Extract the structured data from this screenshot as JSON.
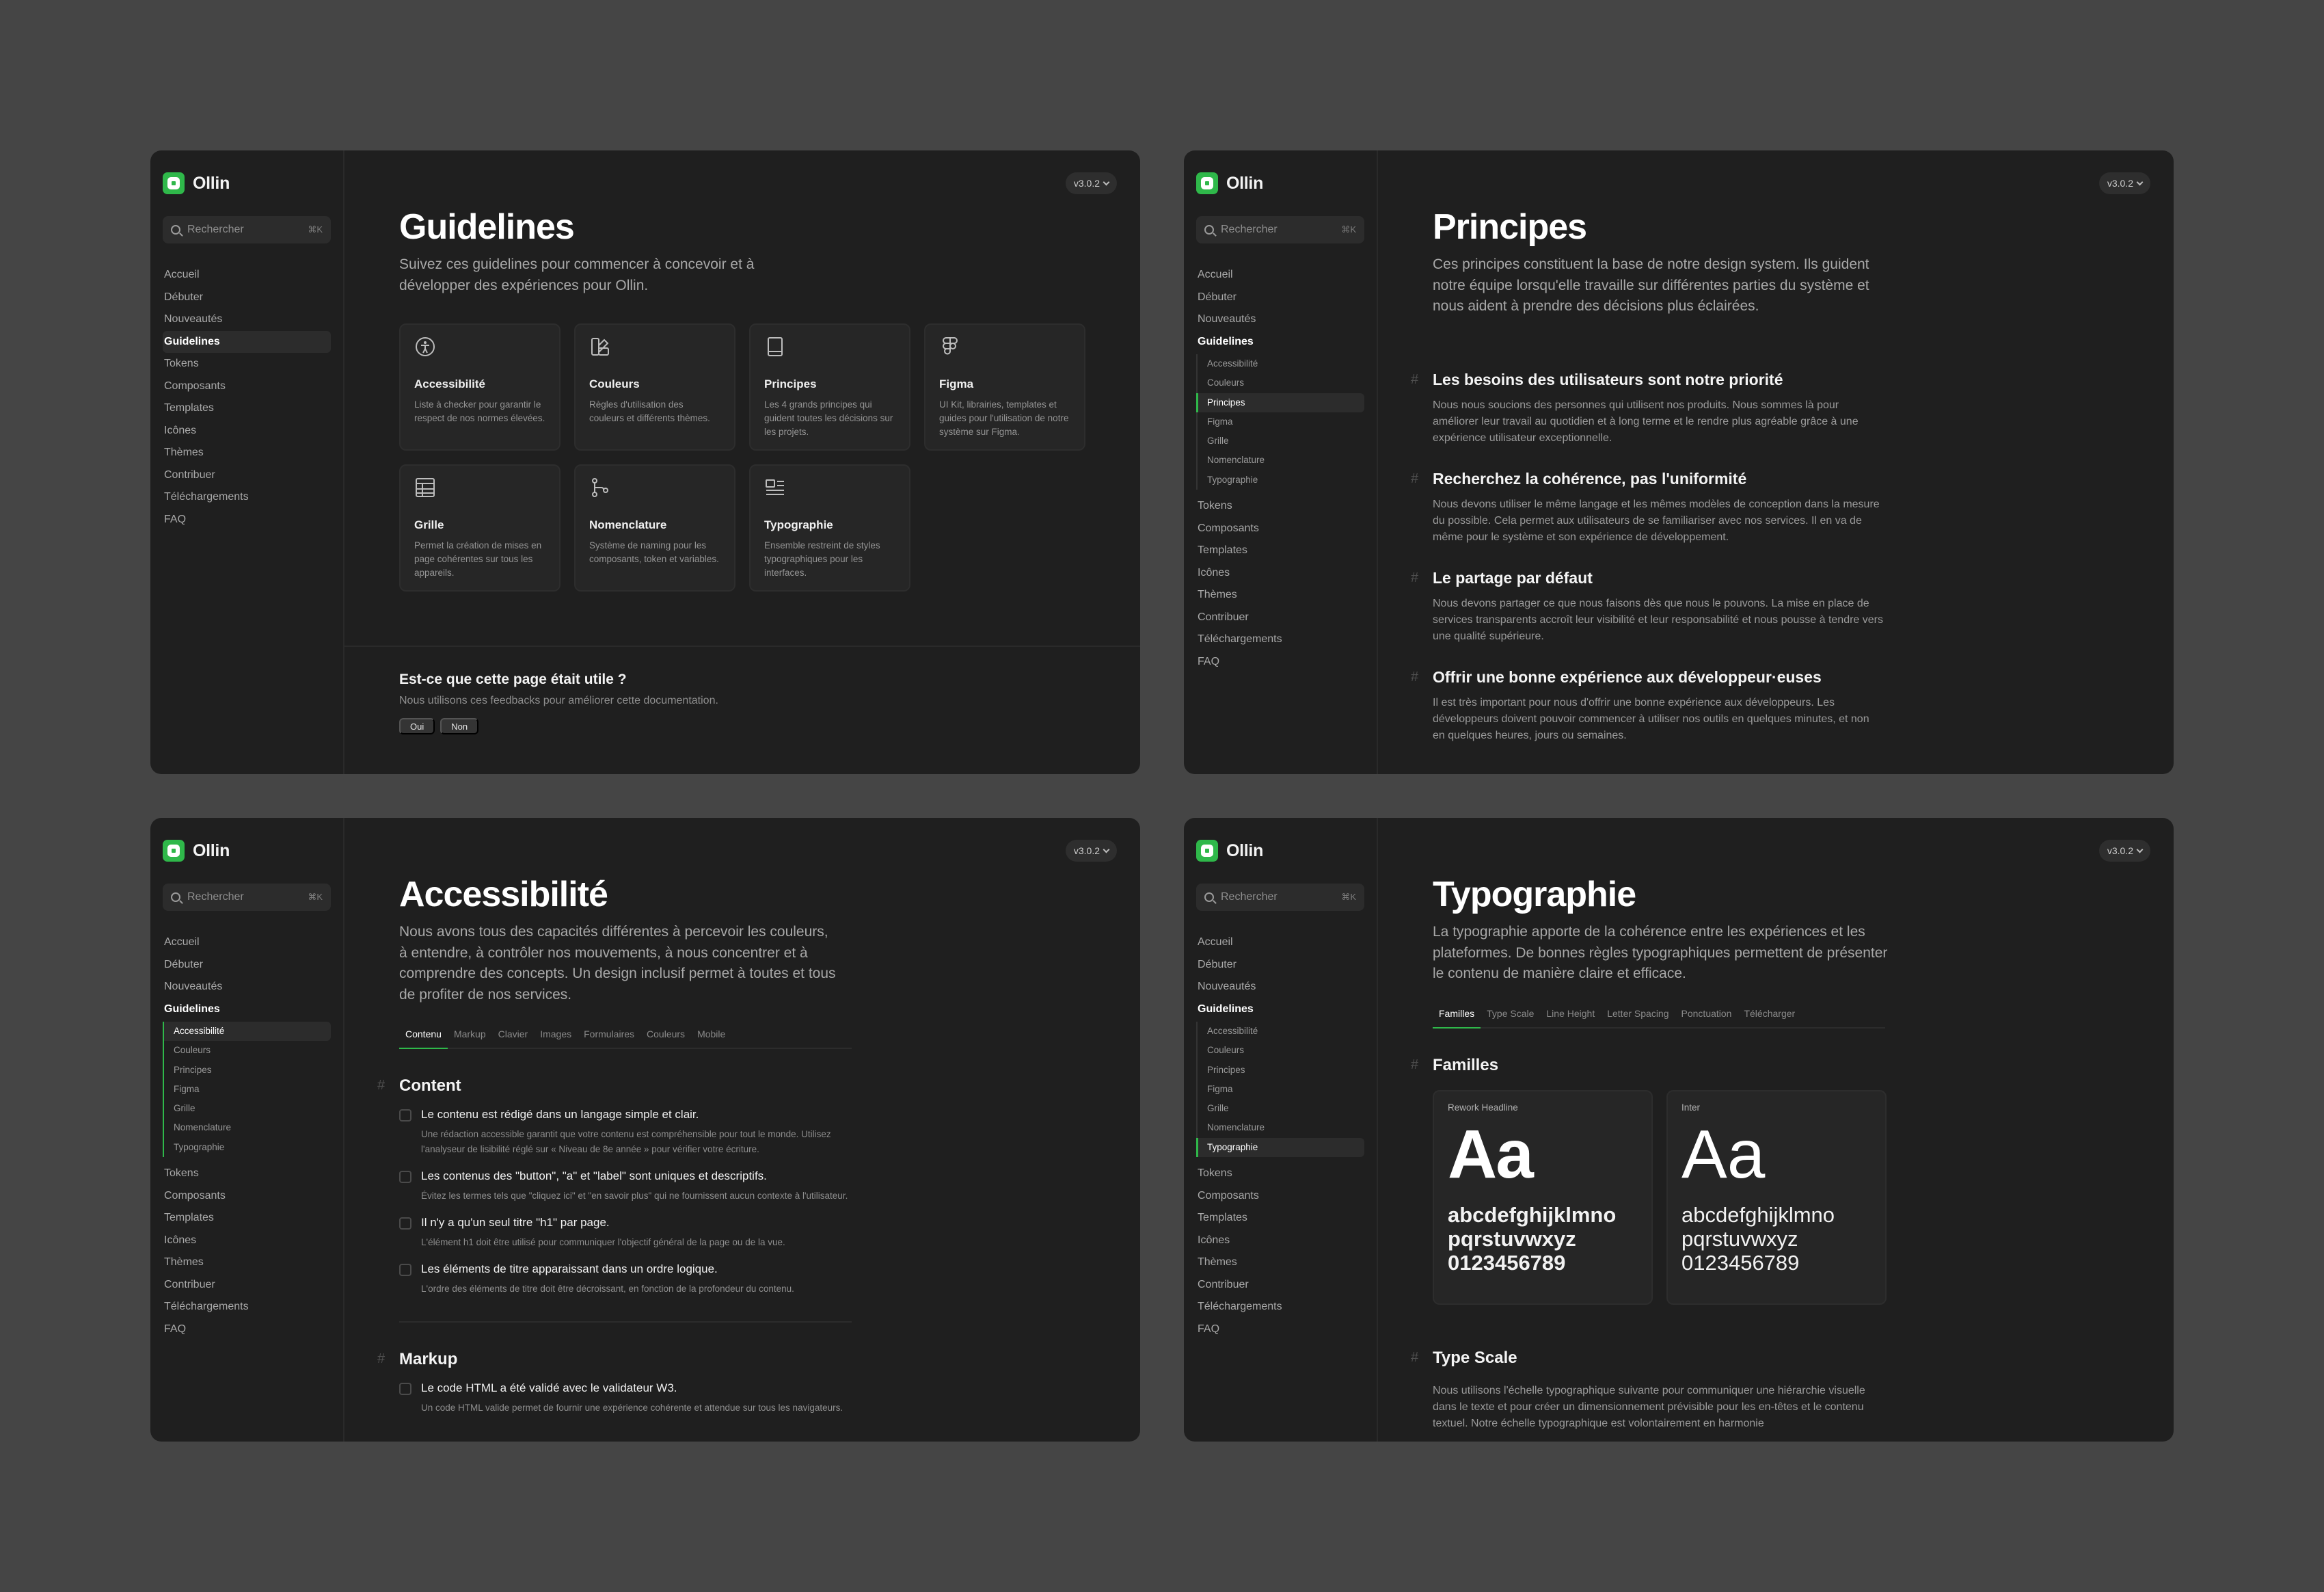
{
  "common": {
    "brand": "Ollin",
    "search_placeholder": "Rechercher",
    "search_shortcut": "⌘K",
    "version": "v3.0.2",
    "accent": "#2fb84a",
    "nav_top": [
      "Accueil",
      "Débuter",
      "Nouveautés",
      "Guidelines"
    ],
    "nav_bottom": [
      "Tokens",
      "Composants",
      "Templates",
      "Icônes",
      "Thèmes",
      "Contribuer",
      "Téléchargements",
      "FAQ"
    ],
    "sub_nav": [
      "Accessibilité",
      "Couleurs",
      "Principes",
      "Figma",
      "Grille",
      "Nomenclature",
      "Typographie"
    ]
  },
  "guidelines": {
    "title": "Guidelines",
    "lead": "Suivez ces guidelines pour commencer à concevoir et à développer des expériences pour Ollin.",
    "cards": [
      {
        "icon": "accessibility-icon",
        "title": "Accessibilité",
        "desc": "Liste à checker pour garantir le respect de nos normes élevées."
      },
      {
        "icon": "palette-icon",
        "title": "Couleurs",
        "desc": "Règles d'utilisation des couleurs et différents thèmes."
      },
      {
        "icon": "book-icon",
        "title": "Principes",
        "desc": "Les 4 grands principes qui guident toutes les décisions sur les projets."
      },
      {
        "icon": "figma-icon",
        "title": "Figma",
        "desc": "UI Kit, librairies, templates et guides pour l'utilisation de notre système sur Figma."
      },
      {
        "icon": "grid-icon",
        "title": "Grille",
        "desc": "Permet la création de mises en page cohérentes sur tous les appareils."
      },
      {
        "icon": "nodes-icon",
        "title": "Nomenclature",
        "desc": "Système de naming pour les composants, token et variables."
      },
      {
        "icon": "text-icon",
        "title": "Typographie",
        "desc": "Ensemble restreint de styles typographiques pour les interfaces."
      }
    ],
    "feedback": {
      "title": "Est-ce que cette page était utile ?",
      "subtitle": "Nous utilisons ces feedbacks pour améliorer cette documentation.",
      "yes": "Oui",
      "no": "Non"
    }
  },
  "principes": {
    "title": "Principes",
    "lead": "Ces principes constituent la base de notre design system. Ils guident notre équipe lorsqu'elle travaille sur différentes parties du système et nous aident à prendre des décisions plus éclairées.",
    "items": [
      {
        "title": "Les besoins des utilisateurs sont notre priorité",
        "text": "Nous nous soucions des personnes qui utilisent nos produits. Nous sommes là pour améliorer leur travail au quotidien et à long terme et le rendre plus agréable grâce à une expérience utilisateur exceptionnelle."
      },
      {
        "title": "Recherchez la cohérence, pas l'uniformité",
        "text": "Nous devons utiliser le même langage et les mêmes modèles de conception dans la mesure du possible. Cela permet aux utilisateurs de se familiariser avec nos services. Il en va de même pour le système et son expérience de développement."
      },
      {
        "title": "Le partage par défaut",
        "text": "Nous devons partager ce que nous faisons dès que nous le pouvons. La mise en place de services transparents accroît leur visibilité et leur responsabilité et nous pousse à tendre vers une qualité supérieure."
      },
      {
        "title": "Offrir une bonne expérience aux développeur·euses",
        "text": "Il est très important pour nous d'offrir une bonne expérience aux développeurs. Les développeurs doivent pouvoir commencer à utiliser nos outils en quelques minutes, et non en quelques heures, jours ou semaines."
      }
    ]
  },
  "accessibilite": {
    "title": "Accessibilité",
    "lead": "Nous avons tous des capacités différentes à percevoir les couleurs, à entendre, à contrôler nos mouvements, à nous concentrer et à comprendre des concepts. Un design inclusif permet à toutes et tous de profiter de nos services.",
    "tabs": [
      "Contenu",
      "Markup",
      "Clavier",
      "Images",
      "Formulaires",
      "Couleurs",
      "Mobile"
    ],
    "content_title": "Content",
    "content_items": [
      {
        "title": "Le contenu est rédigé dans un langage simple et clair.",
        "desc": "Une rédaction accessible garantit que votre contenu est compréhensible pour tout le monde. Utilisez l'analyseur de lisibilité réglé sur « Niveau de 8e année » pour vérifier votre écriture."
      },
      {
        "title": "Les contenus des \"button\", \"a\" et \"label\" sont uniques et descriptifs.",
        "desc": "Évitez les termes tels que \"cliquez ici\" et \"en savoir plus\" qui ne fournissent aucun contexte à l'utilisateur."
      },
      {
        "title": "Il n'y a qu'un seul titre \"h1\" par page.",
        "desc": "L'élément h1 doit être utilisé pour communiquer l'objectif général de la page ou de la vue."
      },
      {
        "title": "Les éléments de titre apparaissant dans un ordre logique.",
        "desc": "L'ordre des éléments de titre doit être décroissant, en fonction de la profondeur du contenu."
      }
    ],
    "markup_title": "Markup",
    "markup_items": [
      {
        "title": "Le code HTML a été validé avec le validateur W3.",
        "desc": "Un code HTML valide permet de fournir une expérience cohérente et attendue sur tous les navigateurs."
      }
    ]
  },
  "typographie": {
    "title": "Typographie",
    "lead": "La typographie apporte de la cohérence entre les expériences et les plateformes. De bonnes règles typographiques permettent de présenter le contenu de manière claire et efficace.",
    "tabs": [
      "Familles",
      "Type Scale",
      "Line Height",
      "Letter Spacing",
      "Ponctuation",
      "Télécharger"
    ],
    "families_title": "Familles",
    "families": [
      {
        "name": "Rework Headline",
        "sample": "Aa",
        "lower": "abcdefghijklmno",
        "lower2": "pqrstuvwxyz",
        "digits": "0123456789"
      },
      {
        "name": "Inter",
        "sample": "Aa",
        "lower": "abcdefghijklmno",
        "lower2": "pqrstuvwxyz",
        "digits": "0123456789"
      }
    ],
    "scale_title": "Type Scale",
    "scale_text": "Nous utilisons l'échelle typographique suivante pour communiquer une hiérarchie visuelle dans le texte et pour créer un dimensionnement prévisible pour les en-têtes et le contenu textuel. Notre échelle typographique est volontairement en harmonie"
  }
}
